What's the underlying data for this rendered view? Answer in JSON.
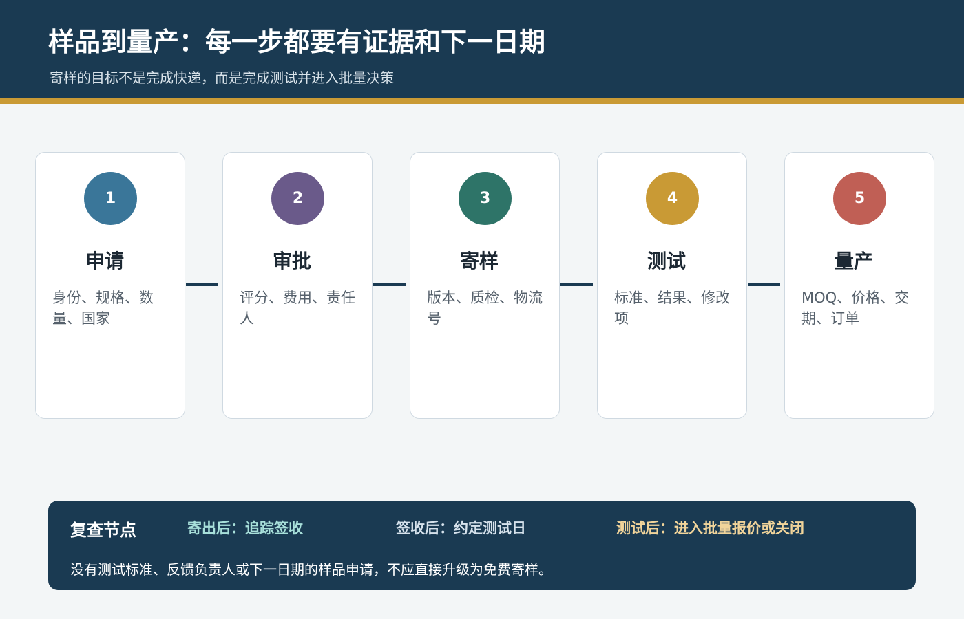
{
  "header": {
    "title": "样品到量产：每一步都要有证据和下一日期",
    "subtitle": "寄样的目标不是完成快递，而是完成测试并进入批量决策"
  },
  "colors": {
    "header_bg": "#1a3a52",
    "accent_rule": "#c99a35",
    "step1": "#3a7699",
    "step2": "#6a5a8a",
    "step3": "#2e7468",
    "step4": "#c99a35",
    "step5": "#c05f55",
    "review_item1": "#a8e0da",
    "review_item2": "#d6e2ec",
    "review_item3": "#f1d49a"
  },
  "steps": [
    {
      "number": "1",
      "title": "申请",
      "desc": "身份、规格、数量、国家"
    },
    {
      "number": "2",
      "title": "审批",
      "desc": "评分、费用、责任人"
    },
    {
      "number": "3",
      "title": "寄样",
      "desc": "版本、质检、物流号"
    },
    {
      "number": "4",
      "title": "测试",
      "desc": "标准、结果、修改项"
    },
    {
      "number": "5",
      "title": "量产",
      "desc": "MOQ、价格、交期、订单"
    }
  ],
  "review": {
    "title": "复查节点",
    "items": [
      "寄出后：追踪签收",
      "签收后：约定测试日",
      "测试后：进入批量报价或关闭"
    ],
    "note": "没有测试标准、反馈负责人或下一日期的样品申请，不应直接升级为免费寄样。"
  }
}
